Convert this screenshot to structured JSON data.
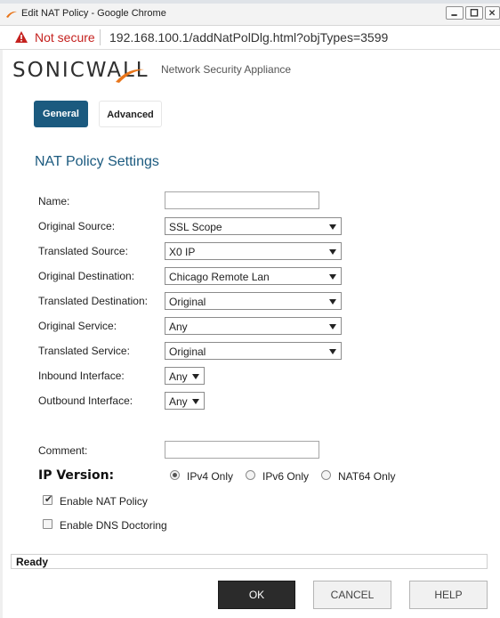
{
  "window": {
    "title": "Edit NAT Policy - Google Chrome"
  },
  "address_bar": {
    "security_label": "Not secure",
    "url": "192.168.100.1/addNatPolDlg.html?objTypes=3599"
  },
  "header": {
    "brand": "SONICWALL",
    "tagline": "Network Security Appliance"
  },
  "tabs": [
    {
      "label": "General",
      "active": true
    },
    {
      "label": "Advanced",
      "active": false
    }
  ],
  "section": {
    "title": "NAT Policy Settings"
  },
  "fields": {
    "name": {
      "label": "Name:",
      "value": ""
    },
    "original_source": {
      "label": "Original Source:",
      "value": "SSL Scope"
    },
    "translated_source": {
      "label": "Translated Source:",
      "value": "X0 IP"
    },
    "original_destination": {
      "label": "Original Destination:",
      "value": "Chicago Remote Lan"
    },
    "translated_destination": {
      "label": "Translated Destination:",
      "value": "Original"
    },
    "original_service": {
      "label": "Original Service:",
      "value": "Any"
    },
    "translated_service": {
      "label": "Translated Service:",
      "value": "Original"
    },
    "inbound_interface": {
      "label": "Inbound Interface:",
      "value": "Any"
    },
    "outbound_interface": {
      "label": "Outbound Interface:",
      "value": "Any"
    },
    "comment": {
      "label": "Comment:",
      "value": ""
    }
  },
  "ip_version": {
    "label": "IP Version:",
    "options": [
      {
        "label": "IPv4 Only",
        "selected": true
      },
      {
        "label": "IPv6 Only",
        "selected": false
      },
      {
        "label": "NAT64 Only",
        "selected": false
      }
    ]
  },
  "checkboxes": [
    {
      "label": "Enable NAT Policy",
      "checked": true
    },
    {
      "label": "Enable DNS Doctoring",
      "checked": false
    }
  ],
  "status": {
    "text": "Ready"
  },
  "buttons": {
    "ok": "OK",
    "cancel": "CANCEL",
    "help": "HELP"
  },
  "colors": {
    "accent": "#1b5a7f",
    "brand_orange": "#e8751a",
    "warning_red": "#c5221f"
  }
}
